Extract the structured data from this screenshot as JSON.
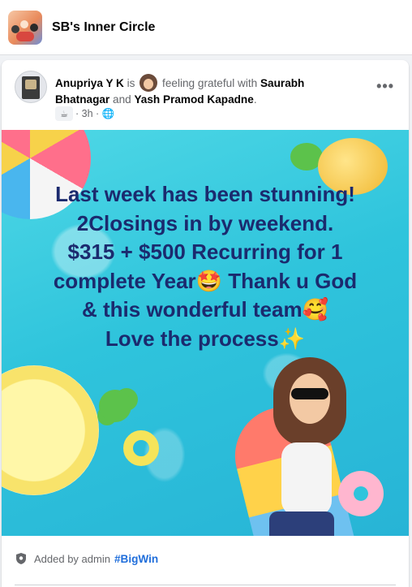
{
  "group": {
    "name": "SB's Inner Circle"
  },
  "post": {
    "author": "Anupriya Y K",
    "is_text": "is",
    "feeling_text": "feeling grateful with",
    "tagged_1": "Saurabh Bhatnagar",
    "and_text": "and",
    "tagged_2": "Yash Pramod Kapadne",
    "period": ".",
    "activity_icon": "coffee-cup-icon",
    "time": "3h",
    "dot": "·",
    "audience_icon": "globe-icon",
    "more_label": "•••",
    "image_lines": [
      "Last week has been stunning!",
      "2Closings in by weekend.",
      "$315 + $500 Recurring for 1",
      "complete Year🤩 Thank u God",
      "& this wonderful team🥰",
      "Love the process✨"
    ]
  },
  "footer": {
    "added_by": "Added by admin",
    "hashtag": "#BigWin"
  },
  "colors": {
    "link": "#216fdb",
    "secondary_text": "#65676b",
    "image_text": "#1b2a6e",
    "water": "#2fc4dc"
  }
}
